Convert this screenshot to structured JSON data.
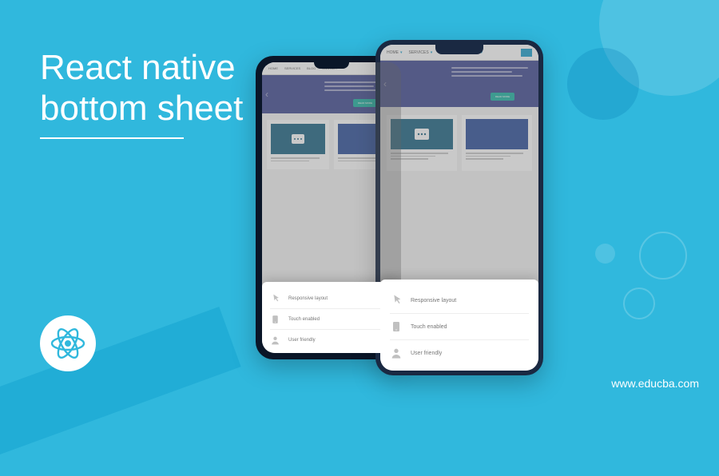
{
  "title_line1": "React native",
  "title_line2": "bottom sheet",
  "url": "www.educba.com",
  "nav": {
    "home": "HOME",
    "services": "SERVICES",
    "blog": "BLOG",
    "contact": "CONTACT"
  },
  "hero_button": "READ MORE",
  "sheet": {
    "item1": "Responsive layout",
    "item2": "Touch enabled",
    "item3": "User friendly"
  }
}
